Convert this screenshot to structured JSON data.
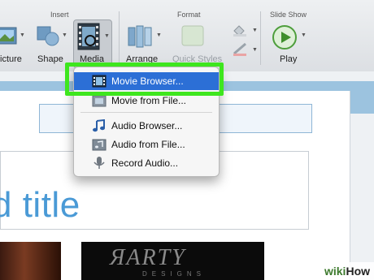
{
  "ribbon": {
    "groups": {
      "insert": "Insert",
      "format": "Format",
      "slide_show": "Slide Show"
    },
    "buttons": {
      "picture": "icture",
      "shape": "Shape",
      "media": "Media",
      "arrange": "Arrange",
      "quick_styles": "Quick Styles",
      "play": "Play"
    }
  },
  "media_menu": {
    "items": [
      {
        "label": "Movie Browser...",
        "icon": "film-strip-icon",
        "selected": true
      },
      {
        "label": "Movie from File...",
        "icon": "movie-file-icon",
        "selected": false
      },
      {
        "label": "Audio Browser...",
        "icon": "music-note-icon",
        "selected": false
      },
      {
        "label": "Audio from File...",
        "icon": "audio-file-icon",
        "selected": false
      },
      {
        "label": "Record Audio...",
        "icon": "microphone-icon",
        "selected": false
      }
    ]
  },
  "slide": {
    "title_fragment": "d title",
    "logo_text": "ЯARTY",
    "logo_sub": "DESIGNS"
  },
  "watermark": {
    "part1": "wiki",
    "part2": "How"
  },
  "colors": {
    "highlight_green": "#3ee61e",
    "selection_blue": "#2c6fd6",
    "title_blue": "#4a9ad6"
  }
}
